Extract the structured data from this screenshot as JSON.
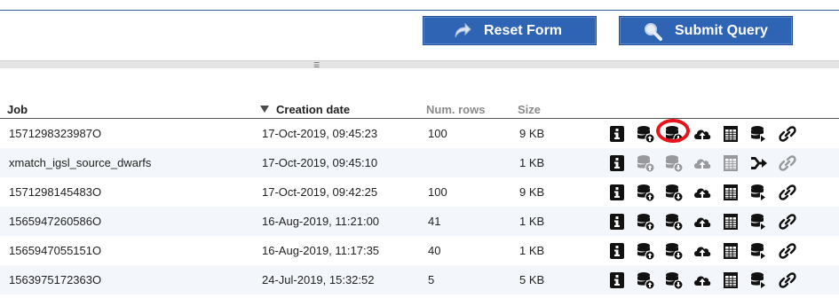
{
  "toolbar": {
    "reset_label": "Reset Form",
    "submit_label": "Submit Query"
  },
  "table": {
    "columns": {
      "job": "Job",
      "creation_date": "Creation date",
      "num_rows": "Num. rows",
      "size": "Size"
    },
    "sort_column": "creation_date",
    "sort_direction": "descending",
    "rows": [
      {
        "job": "1571298323987O",
        "date": "17-Oct-2019, 09:45:23",
        "rows": "100",
        "size": "9 KB",
        "disabled": false
      },
      {
        "job": "xmatch_igsl_source_dwarfs",
        "date": "17-Oct-2019, 09:45:10",
        "rows": "",
        "size": "1 KB",
        "disabled": true
      },
      {
        "job": "1571298145483O",
        "date": "17-Oct-2019, 09:42:25",
        "rows": "100",
        "size": "9 KB",
        "disabled": false
      },
      {
        "job": "1565947260586O",
        "date": "16-Aug-2019, 11:21:00",
        "rows": "41",
        "size": "1 KB",
        "disabled": false
      },
      {
        "job": "1565947055151O",
        "date": "16-Aug-2019, 11:17:35",
        "rows": "40",
        "size": "1 KB",
        "disabled": false
      },
      {
        "job": "1563975172363O",
        "date": "24-Jul-2019, 15:32:52",
        "rows": "5",
        "size": "5 KB",
        "disabled": false
      }
    ]
  },
  "row_actions": [
    "info-icon",
    "upload-table-icon",
    "download-table-icon",
    "cloud-upload-icon",
    "results-table-icon",
    "share-table-icon",
    "link-icon"
  ],
  "highlighted_action": {
    "row": 0,
    "action": "download-table-icon"
  },
  "colors": {
    "button_bg": "#2f63b3",
    "highlight": "#e8131b",
    "alt_row": "#f3f6fa"
  }
}
